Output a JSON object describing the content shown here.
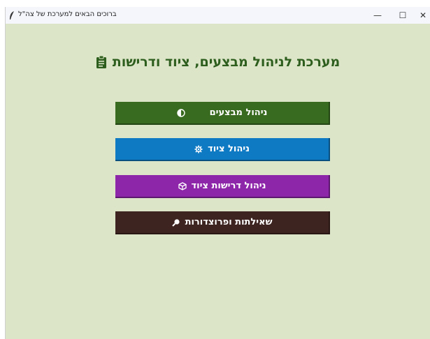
{
  "window": {
    "title": "ברוכים הבאים למערכת של צה\"ל",
    "controls": {
      "minimize": "—",
      "maximize": "☐",
      "close": "✕"
    }
  },
  "main": {
    "heading": "מערכת לניהול מבצעים, ציוד ודרישות",
    "heading_icon": "clipboard-icon"
  },
  "menu": [
    {
      "label": "ניהול מבצעים",
      "icon": "half-circle-icon",
      "color": "#386a20"
    },
    {
      "label": "ניהול ציוד",
      "icon": "gear-icon",
      "color": "#0f7ac4"
    },
    {
      "label": "ניהול דרישות ציוד",
      "icon": "package-icon",
      "color": "#8e26aa"
    },
    {
      "label": "שאילתות ופרוצדורות",
      "icon": "search-icon",
      "color": "#3e2420"
    }
  ],
  "colors": {
    "background": "#dce5c8",
    "heading": "#2e5e1e",
    "titlebar": "#f4f6fb"
  }
}
